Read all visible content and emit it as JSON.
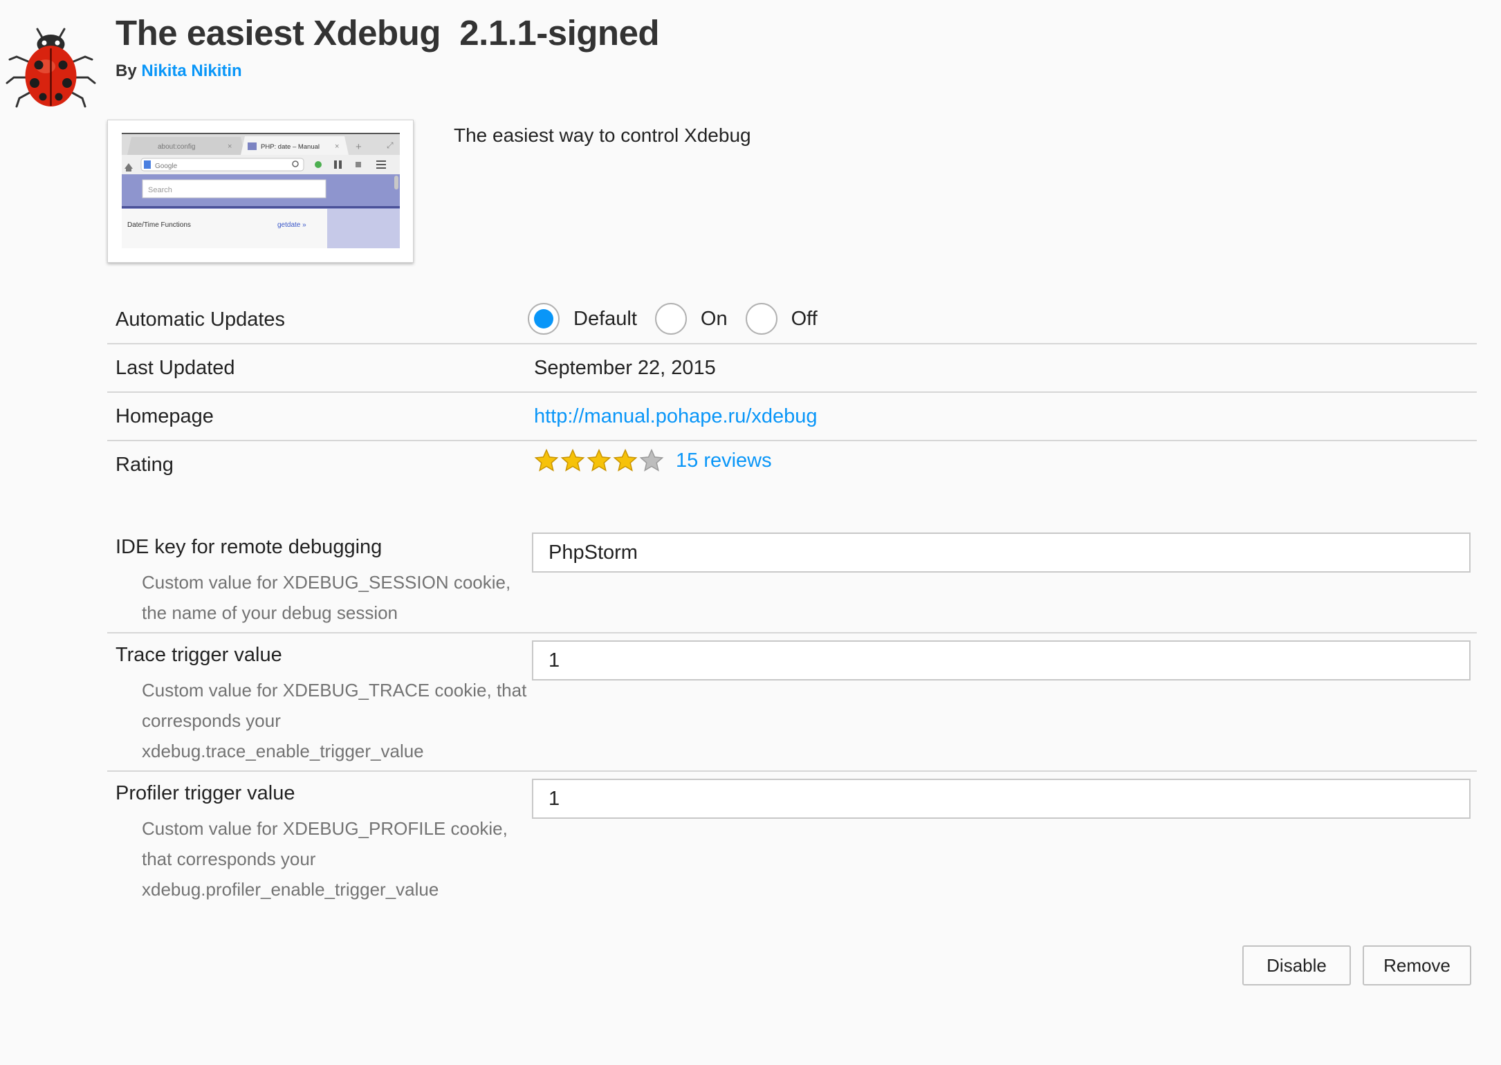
{
  "addon": {
    "icon": "ladybug-icon",
    "title": "The easiest Xdebug  2.1.1-signed",
    "by_label": "By",
    "author": "Nikita Nikitin",
    "description": "The easiest way to control Xdebug"
  },
  "screenshot": {
    "tab1": "about:config",
    "tab2": "PHP: date – Manual",
    "search_engine": "Google",
    "search_placeholder": "Search",
    "left_text": "Date/Time Functions",
    "right_link": "getdate »"
  },
  "details": {
    "updates_label": "Automatic Updates",
    "updates_options": [
      "Default",
      "On",
      "Off"
    ],
    "updates_selected": "Default",
    "last_updated_label": "Last Updated",
    "last_updated_value": "September 22, 2015",
    "homepage_label": "Homepage",
    "homepage_value": "http://manual.pohape.ru/xdebug",
    "rating_label": "Rating",
    "rating_value": 4,
    "rating_max": 5,
    "reviews_link": "15 reviews"
  },
  "prefs": [
    {
      "label": "IDE key for remote debugging",
      "desc_lines": [
        "Custom value for XDEBUG_SESSION cookie,",
        "the name of your debug session"
      ],
      "value": "PhpStorm"
    },
    {
      "label": "Trace trigger value",
      "desc_lines": [
        "Custom value for XDEBUG_TRACE cookie, that",
        "corresponds your",
        "xdebug.trace_enable_trigger_value"
      ],
      "value": "1"
    },
    {
      "label": "Profiler trigger value",
      "desc_lines": [
        "Custom value for XDEBUG_PROFILE cookie,",
        "that corresponds your",
        "xdebug.profiler_enable_trigger_value"
      ],
      "value": "1"
    }
  ],
  "buttons": {
    "disable": "Disable",
    "remove": "Remove"
  },
  "colors": {
    "link": "#0996f8",
    "radio_checked": "#0996f8",
    "star_filled": "#f6c20a",
    "star_empty": "#bdbdbd"
  }
}
